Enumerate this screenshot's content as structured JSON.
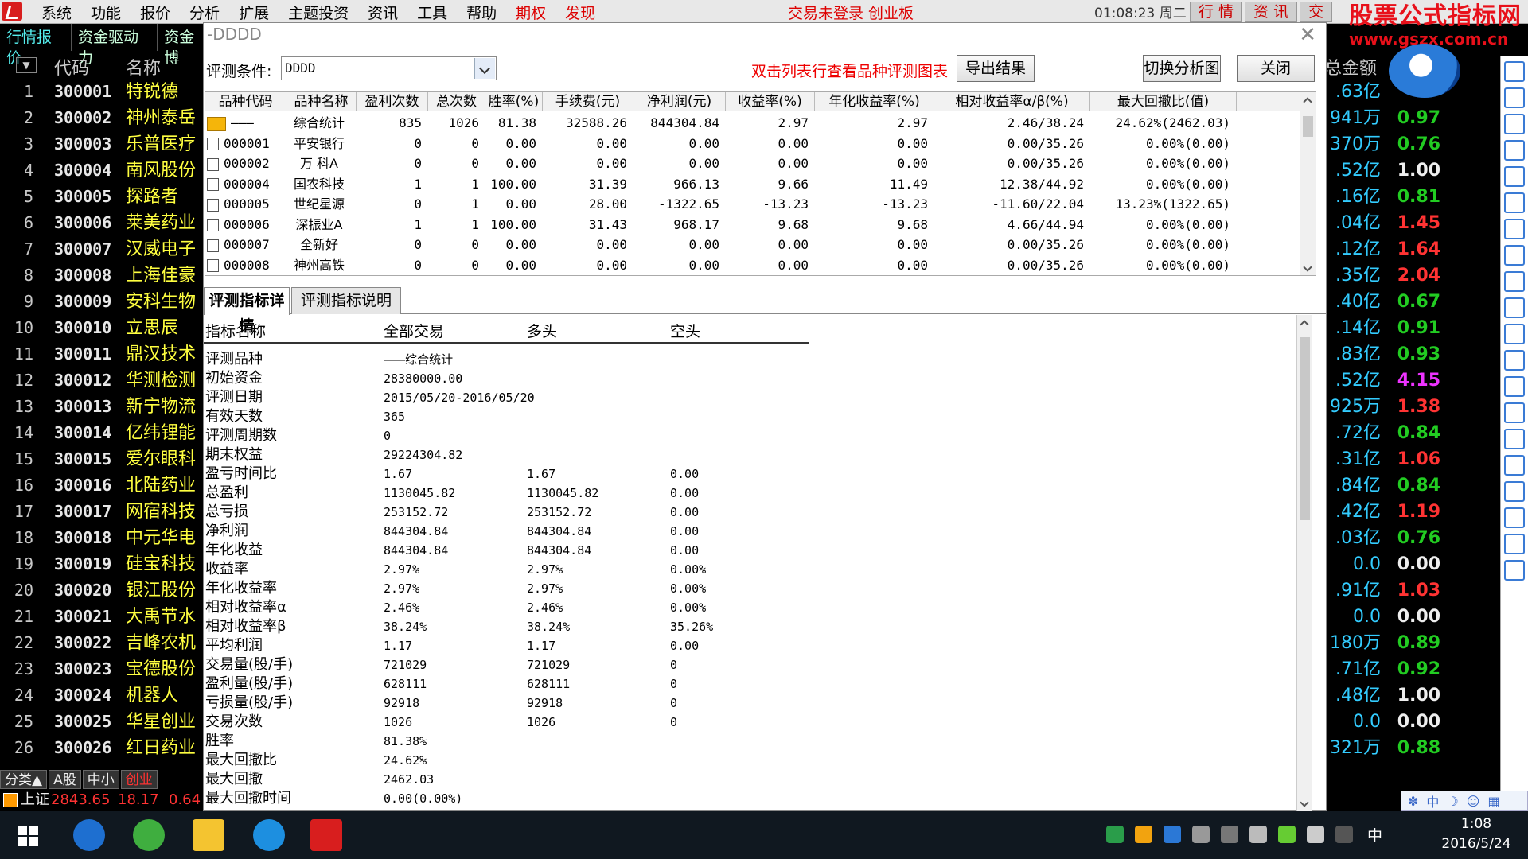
{
  "menubar": {
    "items": [
      "系统",
      "功能",
      "报价",
      "分析",
      "扩展",
      "主题投资",
      "资讯",
      "工具",
      "帮助",
      "期权",
      "发现"
    ],
    "trade_status": "交易未登录  创业板",
    "clock": "01:08:23 周二",
    "right_buttons": [
      "行 情",
      "资 讯",
      "交"
    ],
    "watermark_title": "股票公式指标网",
    "watermark_url": "www.gszx.com.cn"
  },
  "tabs2": [
    "行情报价",
    "资金驱动力",
    "资金博"
  ],
  "stock_list": {
    "headers": {
      "code": "代码",
      "name": "名称"
    },
    "rows": [
      {
        "idx": "1",
        "code": "300001",
        "name": "特锐德"
      },
      {
        "idx": "2",
        "code": "300002",
        "name": "神州泰岳"
      },
      {
        "idx": "3",
        "code": "300003",
        "name": "乐普医疗"
      },
      {
        "idx": "4",
        "code": "300004",
        "name": "南风股份"
      },
      {
        "idx": "5",
        "code": "300005",
        "name": "探路者"
      },
      {
        "idx": "6",
        "code": "300006",
        "name": "莱美药业"
      },
      {
        "idx": "7",
        "code": "300007",
        "name": "汉威电子"
      },
      {
        "idx": "8",
        "code": "300008",
        "name": "上海佳豪"
      },
      {
        "idx": "9",
        "code": "300009",
        "name": "安科生物"
      },
      {
        "idx": "10",
        "code": "300010",
        "name": "立思辰"
      },
      {
        "idx": "11",
        "code": "300011",
        "name": "鼎汉技术"
      },
      {
        "idx": "12",
        "code": "300012",
        "name": "华测检测"
      },
      {
        "idx": "13",
        "code": "300013",
        "name": "新宁物流"
      },
      {
        "idx": "14",
        "code": "300014",
        "name": "亿纬锂能"
      },
      {
        "idx": "15",
        "code": "300015",
        "name": "爱尔眼科"
      },
      {
        "idx": "16",
        "code": "300016",
        "name": "北陆药业"
      },
      {
        "idx": "17",
        "code": "300017",
        "name": "网宿科技"
      },
      {
        "idx": "18",
        "code": "300018",
        "name": "中元华电"
      },
      {
        "idx": "19",
        "code": "300019",
        "name": "硅宝科技"
      },
      {
        "idx": "20",
        "code": "300020",
        "name": "银江股份"
      },
      {
        "idx": "21",
        "code": "300021",
        "name": "大禹节水"
      },
      {
        "idx": "22",
        "code": "300022",
        "name": "吉峰农机"
      },
      {
        "idx": "23",
        "code": "300023",
        "name": "宝德股份"
      },
      {
        "idx": "24",
        "code": "300024",
        "name": "机器人"
      },
      {
        "idx": "25",
        "code": "300025",
        "name": "华星创业"
      },
      {
        "idx": "26",
        "code": "300026",
        "name": "红日药业"
      }
    ]
  },
  "right_quotes": {
    "amount_header": "总金额",
    "rows": [
      {
        "amt": ".63亿",
        "ratio": "",
        "color": "green"
      },
      {
        "amt": "941万",
        "ratio": "0.97",
        "color": "green"
      },
      {
        "amt": "370万",
        "ratio": "0.76",
        "color": "green"
      },
      {
        "amt": ".52亿",
        "ratio": "1.00",
        "color": "white"
      },
      {
        "amt": ".16亿",
        "ratio": "0.81",
        "color": "green"
      },
      {
        "amt": ".04亿",
        "ratio": "1.45",
        "color": "red"
      },
      {
        "amt": ".12亿",
        "ratio": "1.64",
        "color": "red"
      },
      {
        "amt": ".35亿",
        "ratio": "2.04",
        "color": "red"
      },
      {
        "amt": ".40亿",
        "ratio": "0.67",
        "color": "green"
      },
      {
        "amt": ".14亿",
        "ratio": "0.91",
        "color": "green"
      },
      {
        "amt": ".83亿",
        "ratio": "0.93",
        "color": "green"
      },
      {
        "amt": ".52亿",
        "ratio": "4.15",
        "color": "magenta"
      },
      {
        "amt": "925万",
        "ratio": "1.38",
        "color": "red"
      },
      {
        "amt": ".72亿",
        "ratio": "0.84",
        "color": "green"
      },
      {
        "amt": ".31亿",
        "ratio": "1.06",
        "color": "red"
      },
      {
        "amt": ".84亿",
        "ratio": "0.84",
        "color": "green"
      },
      {
        "amt": ".42亿",
        "ratio": "1.19",
        "color": "red"
      },
      {
        "amt": ".03亿",
        "ratio": "0.76",
        "color": "green"
      },
      {
        "amt": "0.0",
        "ratio": "0.00",
        "color": "white"
      },
      {
        "amt": ".91亿",
        "ratio": "1.03",
        "color": "red"
      },
      {
        "amt": "0.0",
        "ratio": "0.00",
        "color": "white"
      },
      {
        "amt": "180万",
        "ratio": "0.89",
        "color": "green"
      },
      {
        "amt": ".71亿",
        "ratio": "0.92",
        "color": "green"
      },
      {
        "amt": ".48亿",
        "ratio": "1.00",
        "color": "white"
      },
      {
        "amt": "0.0",
        "ratio": "0.00",
        "color": "white"
      },
      {
        "amt": "321万",
        "ratio": "0.88",
        "color": "green"
      }
    ]
  },
  "bottom": {
    "tabs": [
      "分类▲",
      "A股",
      "中小",
      "创业"
    ],
    "index_name": "上证",
    "index_value": "2843.65",
    "index_change": "18.17",
    "index_pct": "0.64"
  },
  "ime_bar": "中",
  "dialog": {
    "title": "-DDDD",
    "condition_label": "评测条件:",
    "condition_value": "DDDD",
    "hint": "双击列表行查看品种评测图表",
    "export_button": "导出结果",
    "switch_button": "切换分析图",
    "close_button": "关闭",
    "table": {
      "headers": [
        "品种代码",
        "品种名称",
        "盈利次数",
        "总次数",
        "胜率(%)",
        "手续费(元)",
        "净利润(元)",
        "收益率(%)",
        "年化收益率(%)",
        "相对收益率α/β(%)",
        "最大回撤比(值)"
      ],
      "rows": [
        {
          "code": "———",
          "name": "综合统计",
          "win": "835",
          "total": "1026",
          "rate": "81.38",
          "fee": "32588.26",
          "profit": "844304.84",
          "ret": "2.97",
          "annual": "2.97",
          "rel": "2.46/38.24",
          "dd": "24.62%(2462.03)"
        },
        {
          "code": "000001",
          "name": "平安银行",
          "win": "0",
          "total": "0",
          "rate": "0.00",
          "fee": "0.00",
          "profit": "0.00",
          "ret": "0.00",
          "annual": "0.00",
          "rel": "0.00/35.26",
          "dd": "0.00%(0.00)"
        },
        {
          "code": "000002",
          "name": "万  科A",
          "win": "0",
          "total": "0",
          "rate": "0.00",
          "fee": "0.00",
          "profit": "0.00",
          "ret": "0.00",
          "annual": "0.00",
          "rel": "0.00/35.26",
          "dd": "0.00%(0.00)"
        },
        {
          "code": "000004",
          "name": "国农科技",
          "win": "1",
          "total": "1",
          "rate": "100.00",
          "fee": "31.39",
          "profit": "966.13",
          "ret": "9.66",
          "annual": "11.49",
          "rel": "12.38/44.92",
          "dd": "0.00%(0.00)"
        },
        {
          "code": "000005",
          "name": "世纪星源",
          "win": "0",
          "total": "1",
          "rate": "0.00",
          "fee": "28.00",
          "profit": "-1322.65",
          "ret": "-13.23",
          "annual": "-13.23",
          "rel": "-11.60/22.04",
          "dd": "13.23%(1322.65)"
        },
        {
          "code": "000006",
          "name": "深振业A",
          "win": "1",
          "total": "1",
          "rate": "100.00",
          "fee": "31.43",
          "profit": "968.17",
          "ret": "9.68",
          "annual": "9.68",
          "rel": "4.66/44.94",
          "dd": "0.00%(0.00)"
        },
        {
          "code": "000007",
          "name": "全新好",
          "win": "0",
          "total": "0",
          "rate": "0.00",
          "fee": "0.00",
          "profit": "0.00",
          "ret": "0.00",
          "annual": "0.00",
          "rel": "0.00/35.26",
          "dd": "0.00%(0.00)"
        },
        {
          "code": "000008",
          "name": "神州高铁",
          "win": "0",
          "total": "0",
          "rate": "0.00",
          "fee": "0.00",
          "profit": "0.00",
          "ret": "0.00",
          "annual": "0.00",
          "rel": "0.00/35.26",
          "dd": "0.00%(0.00)"
        }
      ]
    },
    "detail_tabs": [
      "评测指标详情",
      "评测指标说明"
    ],
    "detail_headers": [
      "指标名称",
      "全部交易",
      "多头",
      "空头"
    ],
    "detail_rows": [
      {
        "name": "评测品种",
        "all": "———综合统计",
        "long": "",
        "short": ""
      },
      {
        "name": "初始资金",
        "all": "28380000.00",
        "long": "",
        "short": ""
      },
      {
        "name": "评测日期",
        "all": "2015/05/20-2016/05/20",
        "long": "",
        "short": ""
      },
      {
        "name": "有效天数",
        "all": "365",
        "long": "",
        "short": ""
      },
      {
        "name": "评测周期数",
        "all": "0",
        "long": "",
        "short": ""
      },
      {
        "name": "期末权益",
        "all": "29224304.82",
        "long": "",
        "short": ""
      },
      {
        "name": "盈亏时间比",
        "all": "1.67",
        "long": "1.67",
        "short": "0.00"
      },
      {
        "name": "总盈利",
        "all": "1130045.82",
        "long": "1130045.82",
        "short": "0.00"
      },
      {
        "name": "总亏损",
        "all": "253152.72",
        "long": "253152.72",
        "short": "0.00"
      },
      {
        "name": "净利润",
        "all": "844304.84",
        "long": "844304.84",
        "short": "0.00"
      },
      {
        "name": "年化收益",
        "all": "844304.84",
        "long": "844304.84",
        "short": "0.00"
      },
      {
        "name": "收益率",
        "all": "2.97%",
        "long": "2.97%",
        "short": "0.00%"
      },
      {
        "name": "年化收益率",
        "all": "2.97%",
        "long": "2.97%",
        "short": "0.00%"
      },
      {
        "name": "相对收益率α",
        "all": "2.46%",
        "long": "2.46%",
        "short": "0.00%"
      },
      {
        "name": "相对收益率β",
        "all": "38.24%",
        "long": "38.24%",
        "short": "35.26%"
      },
      {
        "name": "平均利润",
        "all": "1.17",
        "long": "1.17",
        "short": "0.00"
      },
      {
        "name": "交易量(股/手)",
        "all": "721029",
        "long": "721029",
        "short": "0"
      },
      {
        "name": "盈利量(股/手)",
        "all": "628111",
        "long": "628111",
        "short": "0"
      },
      {
        "name": "亏损量(股/手)",
        "all": "92918",
        "long": "92918",
        "short": "0"
      },
      {
        "name": "交易次数",
        "all": "1026",
        "long": "1026",
        "short": "0"
      },
      {
        "name": "胜率",
        "all": "81.38%",
        "long": "",
        "short": ""
      },
      {
        "name": "最大回撤比",
        "all": "24.62%",
        "long": "",
        "short": ""
      },
      {
        "name": "最大回撤",
        "all": "2462.03",
        "long": "",
        "short": ""
      },
      {
        "name": "最大回撤时间",
        "all": "0.00(0.00%)",
        "long": "",
        "short": ""
      }
    ]
  },
  "taskbar": {
    "ime": "中",
    "time": "1:08",
    "date": "2016/5/24"
  }
}
